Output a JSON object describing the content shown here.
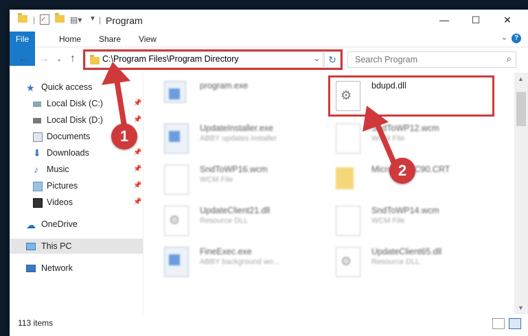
{
  "window": {
    "title": "Program"
  },
  "ribbon": {
    "tabs": [
      "File",
      "Home",
      "Share",
      "View"
    ],
    "help": "?"
  },
  "address": {
    "path": "C:\\Program Files\\Program Directory"
  },
  "search": {
    "placeholder": "Search Program"
  },
  "sidebar": {
    "items": [
      {
        "label": "Quick access",
        "icon": "star-icon"
      },
      {
        "label": "Local Disk (C:)",
        "icon": "drive-icon",
        "pinned": true
      },
      {
        "label": "Local Disk (D:)",
        "icon": "drive-icon",
        "pinned": true
      },
      {
        "label": "Documents",
        "icon": "documents-icon",
        "pinned": true
      },
      {
        "label": "Downloads",
        "icon": "download-icon",
        "pinned": true
      },
      {
        "label": "Music",
        "icon": "music-icon",
        "pinned": true
      },
      {
        "label": "Pictures",
        "icon": "pictures-icon",
        "pinned": true
      },
      {
        "label": "Videos",
        "icon": "videos-icon",
        "pinned": true
      },
      {
        "label": "OneDrive",
        "icon": "cloud-icon"
      },
      {
        "label": "This PC",
        "icon": "pc-icon",
        "selected": true
      },
      {
        "label": "Network",
        "icon": "network-icon"
      }
    ]
  },
  "files": [
    {
      "name": "program.exe",
      "type": "",
      "icon": "program-icon"
    },
    {
      "name": "bdupd.dll",
      "type": "",
      "icon": "dll-gear-icon"
    },
    {
      "name": "UpdateInstaller.exe",
      "type": "ABBY updates installer",
      "icon": "exe-icon"
    },
    {
      "name": "SndToWP12.wcm",
      "type": "WCM File",
      "icon": "doc-icon"
    },
    {
      "name": "SndToWP16.wcm",
      "type": "WCM File",
      "icon": "doc-icon"
    },
    {
      "name": "Microsoft.VC90.CRT",
      "type": "",
      "icon": "folder-icon"
    },
    {
      "name": "UpdateClient21.dll",
      "type": "Resource DLL",
      "icon": "dll-gear-icon"
    },
    {
      "name": "SndToWP14.wcm",
      "type": "WCM File",
      "icon": "doc-icon"
    },
    {
      "name": "FineExec.exe",
      "type": "ABBY background wo...",
      "icon": "exe-icon"
    },
    {
      "name": "UpdateClient65.dll",
      "type": "Resource DLL",
      "icon": "dll-gear-icon"
    }
  ],
  "status": {
    "count": "113 items"
  },
  "annotations": {
    "badge1": "1",
    "badge2": "2",
    "color": "#d0393b"
  }
}
